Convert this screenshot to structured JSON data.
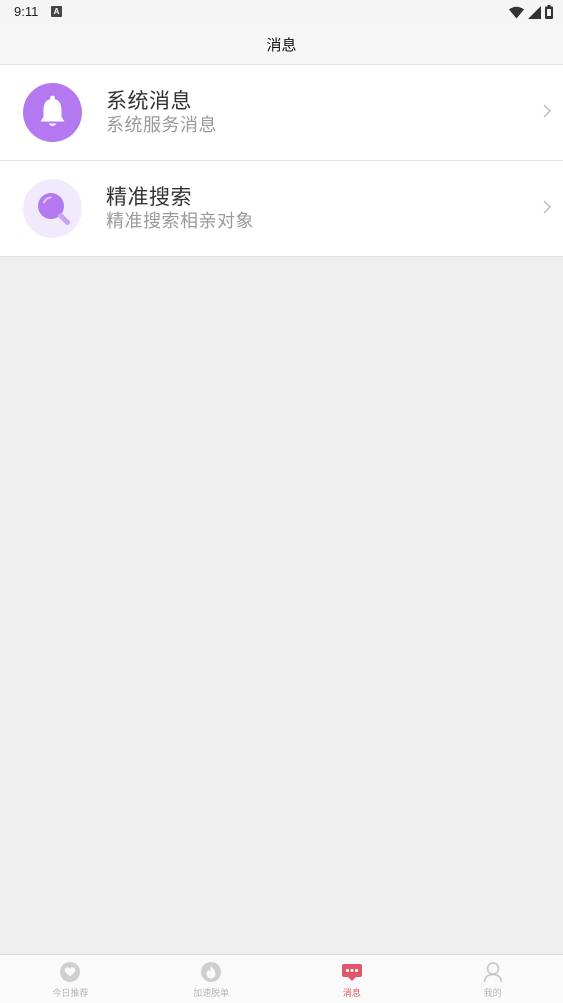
{
  "status_bar": {
    "time": "9:11",
    "notification_glyph": "A"
  },
  "header": {
    "title": "消息"
  },
  "colors": {
    "accent": "#e0566b",
    "purple": "#b479f0",
    "purple_light": "#f1eafd"
  },
  "list": {
    "items": [
      {
        "title": "系统消息",
        "subtitle": "系统服务消息",
        "icon": "bell-icon"
      },
      {
        "title": "精准搜索",
        "subtitle": "精准搜索相亲对象",
        "icon": "magnifier-icon"
      }
    ]
  },
  "tabbar": {
    "tabs": [
      {
        "label": "今日推荐",
        "icon": "heart-icon",
        "active": false
      },
      {
        "label": "加速脱单",
        "icon": "flame-icon",
        "active": false
      },
      {
        "label": "消息",
        "icon": "chat-icon",
        "active": true
      },
      {
        "label": "我的",
        "icon": "person-icon",
        "active": false
      }
    ]
  }
}
